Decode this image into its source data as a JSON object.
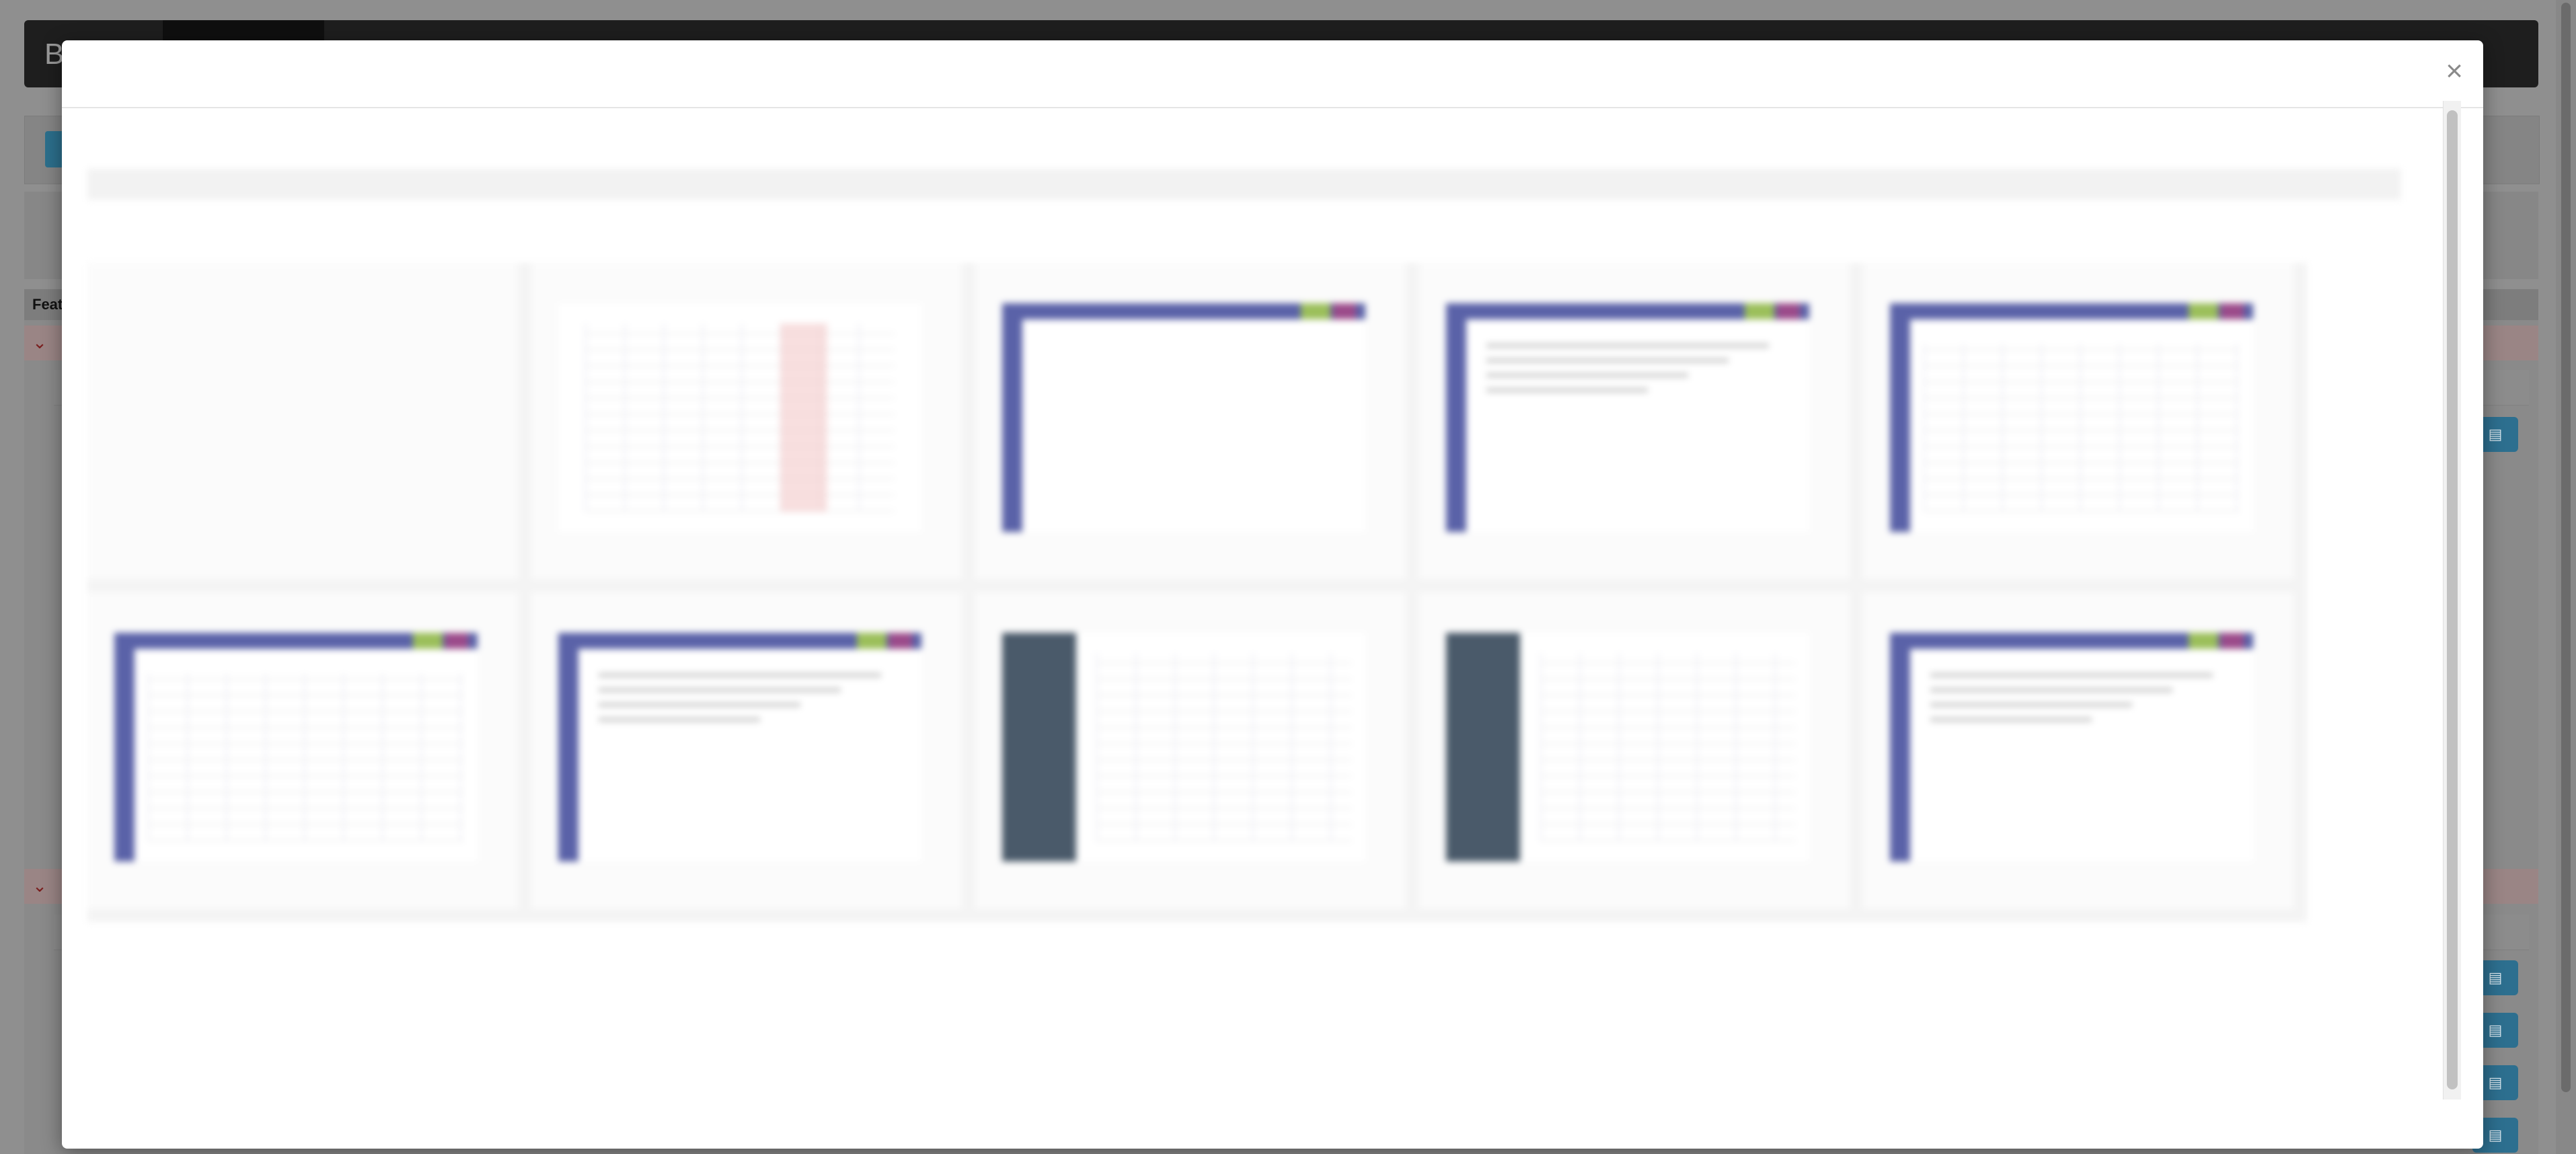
{
  "background": {
    "navbar": {
      "brand": "B"
    },
    "section": {
      "header": "Feat"
    },
    "action_icon": "clipboard-icon"
  },
  "modal": {
    "close_label": "×",
    "preview": {
      "title": "",
      "rows": [
        [
          "blank",
          "spreadsheet",
          "app-empty",
          "app-list",
          "app-table"
        ],
        [
          "app-table",
          "app-list",
          "dark-sidebar-form",
          "dark-sidebar-sheet",
          "app-list"
        ]
      ]
    }
  },
  "colors": {
    "accent": "#2d6f8f",
    "app_header": "#5a62a8",
    "overlay": "#8f8f8f"
  }
}
